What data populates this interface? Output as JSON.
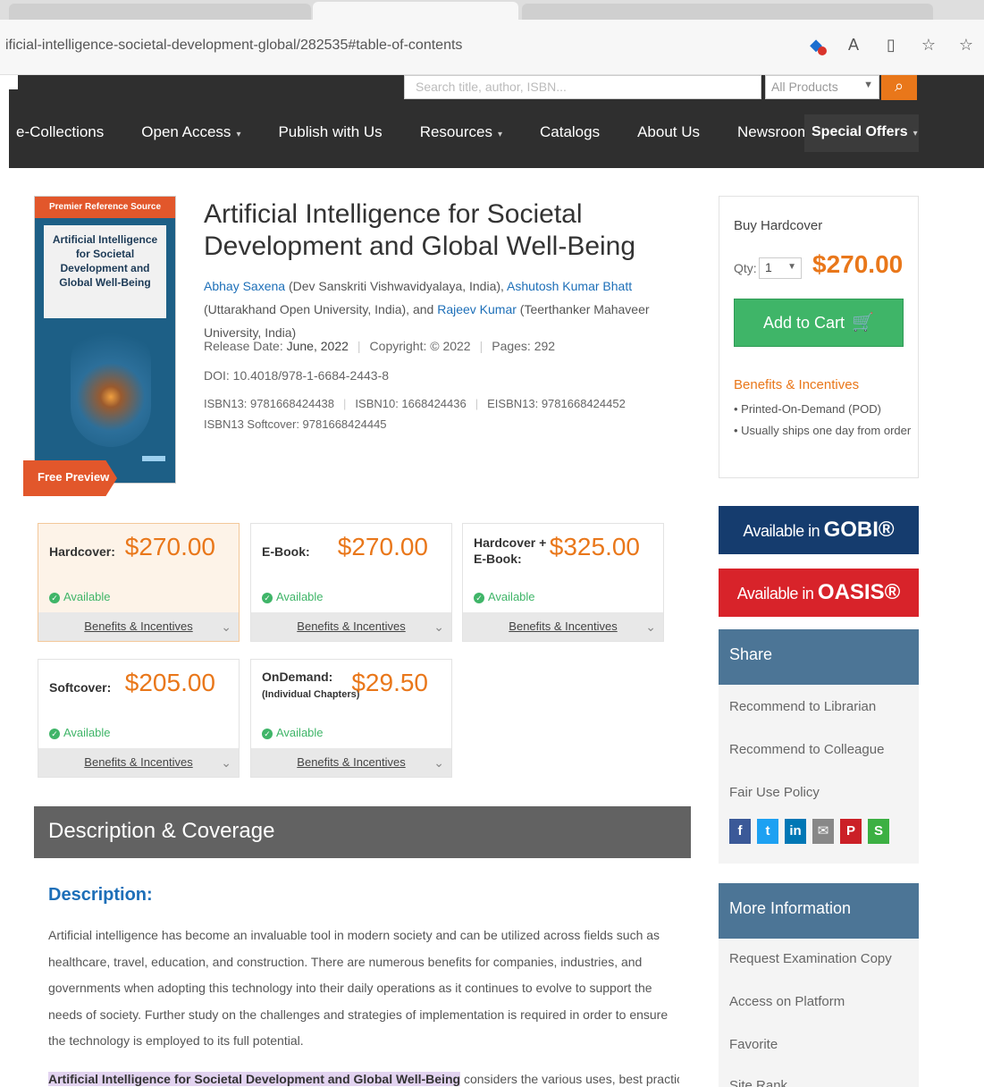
{
  "browser": {
    "url": "ificial-intelligence-societal-development-global/282535#table-of-contents",
    "icons": [
      "translate-icon",
      "read-aloud-icon",
      "split-screen-icon",
      "favorites-icon",
      "collections-icon"
    ]
  },
  "nav": {
    "search_placeholder": "Search title, author, ISBN...",
    "products_label": "All Products",
    "links": [
      {
        "label": "e-Collections",
        "dropdown": false
      },
      {
        "label": "Open Access",
        "dropdown": true
      },
      {
        "label": "Publish with Us",
        "dropdown": false
      },
      {
        "label": "Resources",
        "dropdown": true
      },
      {
        "label": "Catalogs",
        "dropdown": false
      },
      {
        "label": "About Us",
        "dropdown": false
      },
      {
        "label": "Newsroom",
        "dropdown": false
      }
    ],
    "special_offers": "Special Offers",
    "caret": "▾"
  },
  "cover": {
    "series_label": "Premier Reference Source",
    "title": "Artificial Intelligence for Societal Development and Global Well-Being",
    "preview_label": "Free Preview"
  },
  "book": {
    "title": "Artificial Intelligence for Societal Development and Global Well-Being",
    "authors": [
      {
        "name": "Abhay Saxena",
        "affil": " (Dev Sanskriti Vishwavidyalaya, India), "
      },
      {
        "name": "Ashutosh Kumar Bhatt",
        "affil": " (Uttarakhand Open University, India), and "
      },
      {
        "name": "Rajeev Kumar",
        "affil": " (Teerthanker Mahaveer University, India)"
      }
    ],
    "release": "Release Date: ",
    "release_value": "June, 2022",
    "copyright": "Copyright: © 2022",
    "pages": "Pages: 292",
    "doi": "DOI: 10.4018/978-1-6684-2443-8",
    "isbn13": "ISBN13: 9781668424438",
    "isbn10": "ISBN10: 1668424436",
    "eisbn13": "EISBN13: 9781668424452",
    "isbn13_softcover": "ISBN13 Softcover: 9781668424445"
  },
  "buy": {
    "label": "Buy Hardcover",
    "qty_label": "Qty:",
    "qty_value": "1",
    "price": "$270.00",
    "add_to_cart": "Add to Cart",
    "benefits_head": "Benefits & Incentives",
    "benefits": [
      "Printed-On-Demand (POD)",
      "Usually ships one day from order"
    ]
  },
  "formats": [
    {
      "name": "Hardcover:",
      "price": "$270.00",
      "available": "Available",
      "benefits": "Benefits & Incentives"
    },
    {
      "name": "E-Book:",
      "price": "$270.00",
      "available": "Available",
      "benefits": "Benefits & Incentives"
    },
    {
      "name": "Hardcover + E-Book:",
      "price": "$325.00",
      "available": "Available",
      "benefits": "Benefits & Incentives"
    },
    {
      "name": "Softcover:",
      "price": "$205.00",
      "available": "Available",
      "benefits": "Benefits & Incentives"
    },
    {
      "name": "OnDemand:",
      "sub": "(Individual Chapters)",
      "price": "$29.50",
      "available": "Available",
      "benefits": "Benefits & Incentives"
    }
  ],
  "description": {
    "header": "Description & Coverage",
    "title": "Description:",
    "paragraph": "Artificial intelligence has become an invaluable tool in modern society and can be utilized across fields such as healthcare, travel, education, and construction. There are numerous benefits for companies, industries, and governments when adopting this technology into their daily operations as it continues to evolve to support the needs of society. Further study on the challenges and strategies of implementation is required in order to ensure the technology is employed to its full potential.",
    "para2_bold": "Artificial Intelligence for Societal Development and Global Well-Being",
    "para2_rest": " considers the various uses, best practices,"
  },
  "sidebar": {
    "gobi_pre": "Available in ",
    "gobi_brand": "GOBI®",
    "oasis_pre": "Available in ",
    "oasis_brand": "OASIS®",
    "share_head": "Share",
    "share_links": [
      "Recommend to Librarian",
      "Recommend to Colleague",
      "Fair Use Policy"
    ],
    "social": [
      {
        "name": "facebook-icon",
        "glyph": "f",
        "color": "#3b5998"
      },
      {
        "name": "twitter-icon",
        "glyph": "t",
        "color": "#1da1f2"
      },
      {
        "name": "linkedin-icon",
        "glyph": "in",
        "color": "#0077b5"
      },
      {
        "name": "email-icon",
        "glyph": "✉",
        "color": "#888888"
      },
      {
        "name": "pinterest-icon",
        "glyph": "P",
        "color": "#cb2027"
      },
      {
        "name": "sharethis-icon",
        "glyph": "S",
        "color": "#3cb043"
      }
    ],
    "more_head": "More Information",
    "more_links": [
      "Request Examination Copy",
      "Access on Platform",
      "Favorite",
      "Site Rank"
    ]
  },
  "colors": {
    "accent": "#e9771a",
    "link": "#1d6fb8",
    "nav_bg": "#2f2f2f",
    "cart": "#3fb568"
  }
}
